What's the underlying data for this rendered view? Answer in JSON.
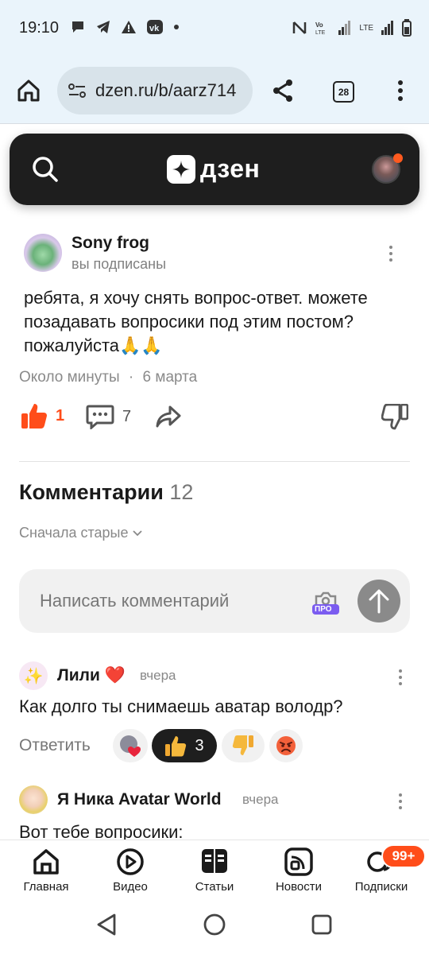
{
  "status_bar": {
    "time": "19:10",
    "network_label": "LTE"
  },
  "browser": {
    "url": "dzen.ru/b/aarz714",
    "tabs_count": "28"
  },
  "header": {
    "logo_text": "дзен"
  },
  "post": {
    "author": "Sony frog",
    "subscription_status": "вы подписаны",
    "text": "ребята, я хочу снять вопрос-ответ. можете позадавать вопросики под этим постом? пожалуйста🙏🙏",
    "time_ago": "Около минуты",
    "separator": "·",
    "date": "6 марта",
    "likes": "1",
    "comments_count": "7"
  },
  "comments_section": {
    "title": "Комментарии",
    "count": "12",
    "sort_label": "Сначала старые",
    "input_placeholder": "Написать комментарий",
    "pro_label": "ПРО"
  },
  "comments": [
    {
      "author": "Лили ❤️",
      "time": "вчера",
      "text": "Как долго ты снимаешь аватар володр?",
      "reply_label": "Ответить",
      "thumbs_up_count": "3"
    },
    {
      "author": "Я Ника Avatar World",
      "time": "вчера",
      "text": "Вот тебе вопросики:"
    }
  ],
  "bottom_nav": {
    "items": [
      {
        "label": "Главная",
        "icon": "home-icon"
      },
      {
        "label": "Видео",
        "icon": "video-play-icon"
      },
      {
        "label": "Статьи",
        "icon": "articles-icon"
      },
      {
        "label": "Новости",
        "icon": "news-icon"
      },
      {
        "label": "Подписки",
        "icon": "subscriptions-icon"
      }
    ],
    "subscriptions_badge": "99+"
  },
  "colors": {
    "accent": "#ff4d1a",
    "header_bg": "#1e1e1e",
    "browser_bg": "#eaf4fb"
  }
}
